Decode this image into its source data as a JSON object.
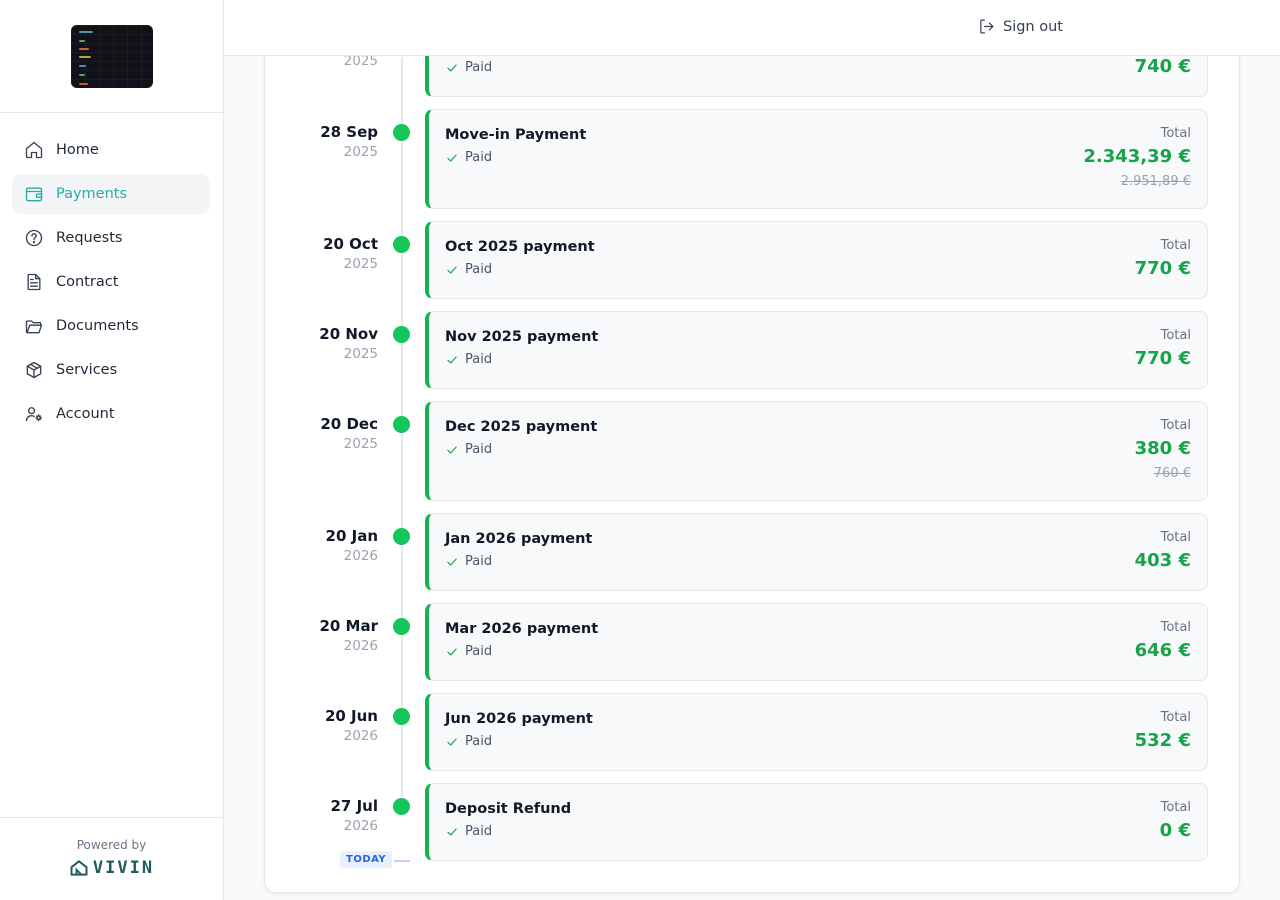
{
  "sidebar": {
    "items": [
      {
        "label": "Home",
        "icon": "home-icon"
      },
      {
        "label": "Payments",
        "icon": "wallet-icon"
      },
      {
        "label": "Requests",
        "icon": "question-icon"
      },
      {
        "label": "Contract",
        "icon": "file-text-icon"
      },
      {
        "label": "Documents",
        "icon": "folder-icon"
      },
      {
        "label": "Services",
        "icon": "box-icon"
      },
      {
        "label": "Account",
        "icon": "user-settings-icon"
      }
    ],
    "active_item": "Payments",
    "powered_by": "Powered by",
    "brand": "VIVIN"
  },
  "topbar": {
    "sign_out": "Sign out"
  },
  "colors": {
    "accent": "#2aaaa4",
    "paid_green": "#16a34a",
    "dot_green": "#16c55a",
    "today_blue": "#2563eb"
  },
  "timeline": {
    "today_label": "TODAY",
    "entries": [
      {
        "day_month": "",
        "year": "2025",
        "title": "",
        "status": "Paid",
        "total_label": "",
        "amount": "740 €",
        "original": ""
      },
      {
        "day_month": "28 Sep",
        "year": "2025",
        "title": "Move-in Payment",
        "status": "Paid",
        "total_label": "Total",
        "amount": "2.343,39 €",
        "original": "2.951,89 €"
      },
      {
        "day_month": "20 Oct",
        "year": "2025",
        "title": "Oct 2025 payment",
        "status": "Paid",
        "total_label": "Total",
        "amount": "770 €",
        "original": ""
      },
      {
        "day_month": "20 Nov",
        "year": "2025",
        "title": "Nov 2025 payment",
        "status": "Paid",
        "total_label": "Total",
        "amount": "770 €",
        "original": ""
      },
      {
        "day_month": "20 Dec",
        "year": "2025",
        "title": "Dec 2025 payment",
        "status": "Paid",
        "total_label": "Total",
        "amount": "380 €",
        "original": "760 €"
      },
      {
        "day_month": "20 Jan",
        "year": "2026",
        "title": "Jan 2026 payment",
        "status": "Paid",
        "total_label": "Total",
        "amount": "403 €",
        "original": ""
      },
      {
        "day_month": "20 Mar",
        "year": "2026",
        "title": "Mar 2026 payment",
        "status": "Paid",
        "total_label": "Total",
        "amount": "646 €",
        "original": ""
      },
      {
        "day_month": "20 Jun",
        "year": "2026",
        "title": "Jun 2026 payment",
        "status": "Paid",
        "total_label": "Total",
        "amount": "532 €",
        "original": ""
      },
      {
        "day_month": "27 Jul",
        "year": "2026",
        "title": "Deposit Refund",
        "status": "Paid",
        "total_label": "Total",
        "amount": "0 €",
        "original": ""
      }
    ]
  }
}
